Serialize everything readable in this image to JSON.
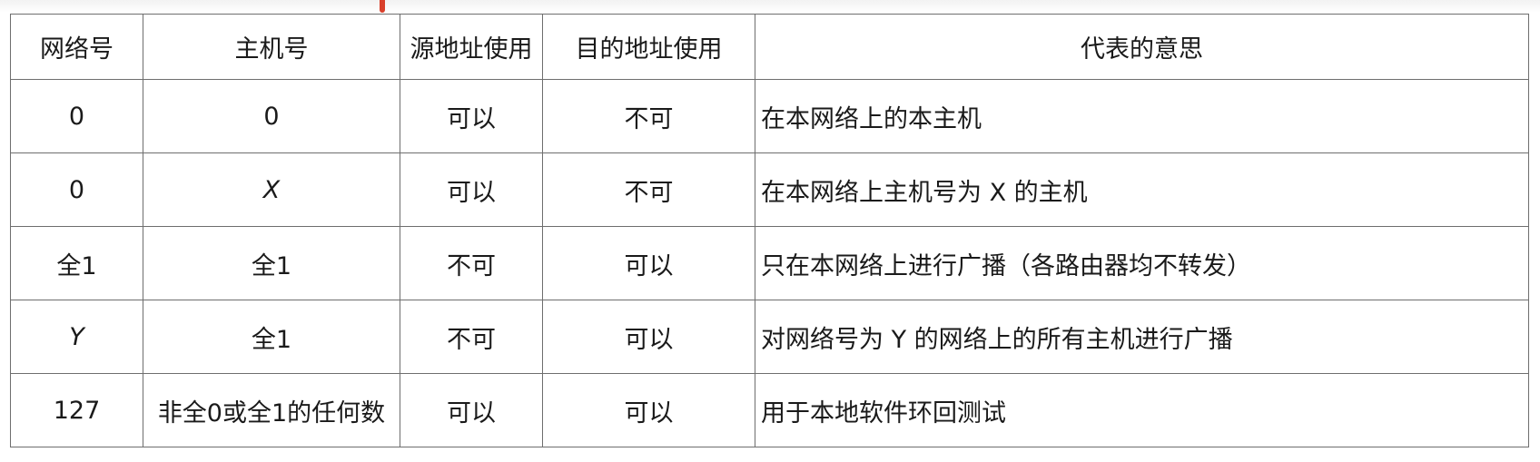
{
  "table": {
    "headers": [
      "网络号",
      "主机号",
      "源地址使用",
      "目的地址使用",
      "代表的意思"
    ],
    "rows": [
      {
        "net": "0",
        "host": "0",
        "src": "可以",
        "dst": "不可",
        "meaning": "在本网络上的本主机"
      },
      {
        "net": "0",
        "host": "X",
        "src": "可以",
        "dst": "不可",
        "meaning": "在本网络上主机号为 X 的主机"
      },
      {
        "net": "全1",
        "host": "全1",
        "src": "不可",
        "dst": "可以",
        "meaning": "只在本网络上进行广播（各路由器均不转发）"
      },
      {
        "net": "Y",
        "host": "全1",
        "src": "不可",
        "dst": "可以",
        "meaning": "对网络号为 Y 的网络上的所有主机进行广播"
      },
      {
        "net": "127",
        "host": "非全0或全1的任何数",
        "src": "可以",
        "dst": "可以",
        "meaning": "用于本地软件环回测试"
      }
    ]
  },
  "colors": {
    "border": "#6e6e6e",
    "text": "#1a1a1a",
    "cursor_mark": "#d9402b"
  }
}
